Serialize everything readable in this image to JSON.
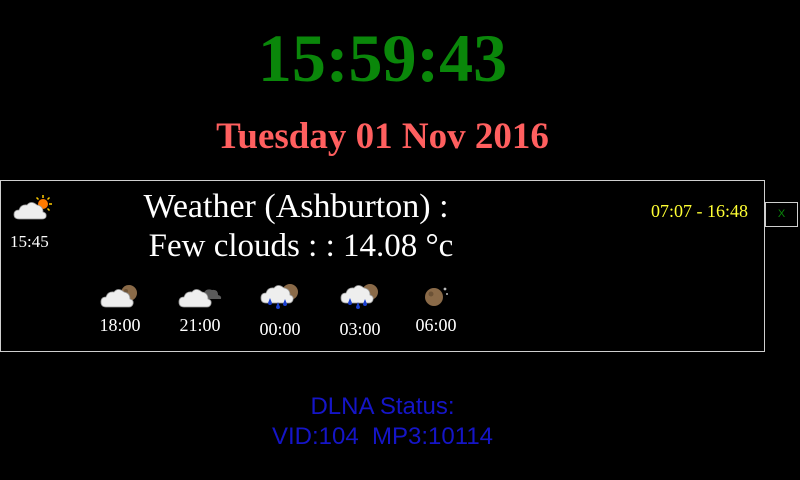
{
  "clock": {
    "time": "15:59:43"
  },
  "date": {
    "text": "Tuesday 01 Nov 2016"
  },
  "weather": {
    "current_icon": "sun-behind-cloud-icon",
    "current_time": "15:45",
    "title": "Weather (Ashburton) :",
    "description": "Few clouds : : 14.08 °c",
    "sun_times": "07:07 - 16:48",
    "forecast": [
      {
        "time": "18:00",
        "icon": "cloud-moon-icon"
      },
      {
        "time": "21:00",
        "icon": "cloud-dark-cloud-icon"
      },
      {
        "time": "00:00",
        "icon": "rain-cloud-moon-icon"
      },
      {
        "time": "03:00",
        "icon": "rain-cloud-moon-icon"
      },
      {
        "time": "06:00",
        "icon": "moon-icon"
      }
    ]
  },
  "close_button": {
    "label": "X"
  },
  "dlna": {
    "title": "DLNA Status:",
    "counts": "VID:104  MP3:10114"
  },
  "colors": {
    "clock": "#0a870a",
    "date": "#ff5f5f",
    "sun_times": "#ffff33",
    "dlna": "#1515c8"
  }
}
